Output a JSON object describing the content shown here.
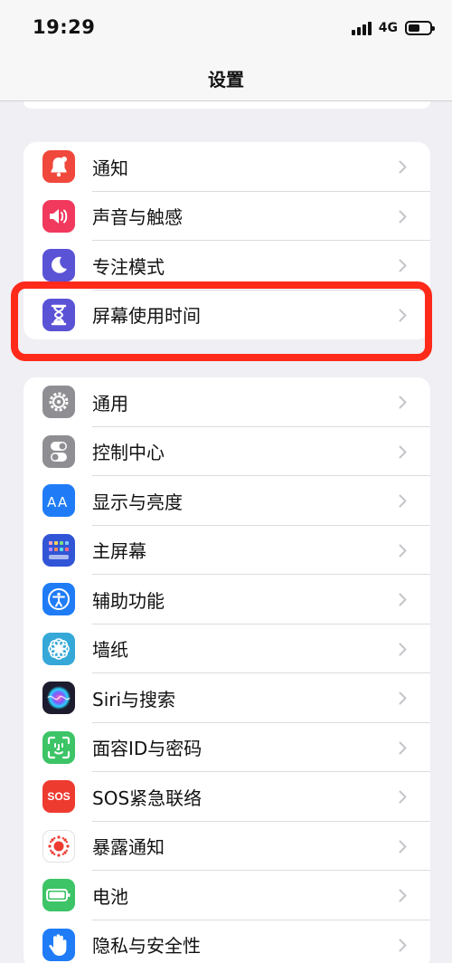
{
  "status_bar": {
    "time": "19:29",
    "network": "4G",
    "battery_level": 0.55
  },
  "nav": {
    "title": "设置"
  },
  "group1": [
    {
      "label": "通知",
      "icon": "bell-icon",
      "color": "#f0483c"
    },
    {
      "label": "声音与触感",
      "icon": "speaker-icon",
      "color": "#f0395d"
    },
    {
      "label": "专注模式",
      "icon": "moon-icon",
      "color": "#5a53d6"
    },
    {
      "label": "屏幕使用时间",
      "icon": "hourglass-icon",
      "color": "#5a53d6"
    }
  ],
  "group2": [
    {
      "label": "通用",
      "icon": "gear-icon",
      "color": "#8e8e93"
    },
    {
      "label": "控制中心",
      "icon": "toggles-icon",
      "color": "#8e8e93"
    },
    {
      "label": "显示与亮度",
      "icon": "text-size-icon",
      "color": "#1f7cf6"
    },
    {
      "label": "主屏幕",
      "icon": "home-grid-icon",
      "color": "#3155d6"
    },
    {
      "label": "辅助功能",
      "icon": "accessibility-icon",
      "color": "#1f7cf6"
    },
    {
      "label": "墙纸",
      "icon": "flower-icon",
      "color": "#35a8d8"
    },
    {
      "label": "Siri与搜索",
      "icon": "siri-icon",
      "color": "#1c1c2e"
    },
    {
      "label": "面容ID与密码",
      "icon": "face-id-icon",
      "color": "#3cc466"
    },
    {
      "label": "SOS紧急联络",
      "icon": "sos-icon",
      "icon_text": "SOS",
      "color": "#ee3b30"
    },
    {
      "label": "暴露通知",
      "icon": "exposure-icon",
      "color": "#ffffff"
    },
    {
      "label": "电池",
      "icon": "battery-icon",
      "color": "#3cc466"
    },
    {
      "label": "隐私与安全性",
      "icon": "hand-icon",
      "color": "#1f7cf6"
    }
  ],
  "highlight_color": "#ff2a1a"
}
